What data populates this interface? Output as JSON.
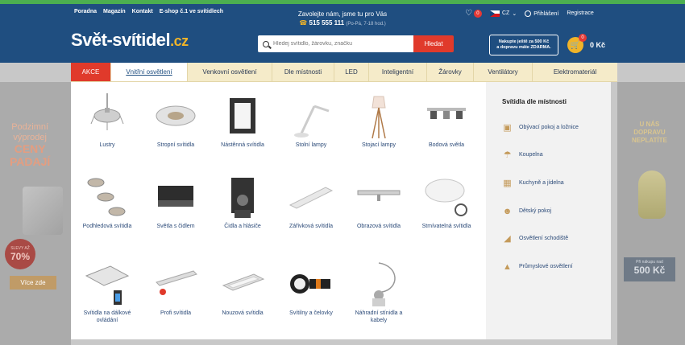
{
  "header": {
    "top_links": [
      "Poradna",
      "Magazín",
      "Kontakt",
      "E-shop č.1 ve svítidlech"
    ],
    "phone_title": "Zavolejte nám, jsme tu pro Vás",
    "phone_number": "515 555 111",
    "phone_hours": "(Po-Pá, 7-18 hod.)",
    "wishlist_count": "0",
    "lang": "CZ",
    "login": "Přihlášení",
    "register": "Registrace",
    "logo_main": "Svět-svítidel",
    "logo_tld": ".cz",
    "search_placeholder": "Hledej svítidlo, žárovku, značku",
    "search_button": "Hledat",
    "promo_line1": "Nakupte ještě za 500 Kč",
    "promo_line2": "a dopravu máte ZDARMA.",
    "cart_count": "0",
    "cart_price": "0 Kč"
  },
  "nav": {
    "items": [
      {
        "label": "AKCE"
      },
      {
        "label": "Vnitřní osvětlení"
      },
      {
        "label": "Venkovní osvětlení"
      },
      {
        "label": "Dle místnosti"
      },
      {
        "label": "LED"
      },
      {
        "label": "Inteligentní"
      },
      {
        "label": "Žárovky"
      },
      {
        "label": "Ventilátory"
      },
      {
        "label": "Elektromateriál"
      }
    ]
  },
  "menu": {
    "items": [
      {
        "label": "Lustry",
        "icon": "chandelier-icon"
      },
      {
        "label": "Stropní svítidla",
        "icon": "ceiling-light-icon"
      },
      {
        "label": "Nástěnná svítidla",
        "icon": "wall-light-icon"
      },
      {
        "label": "Stolní lampy",
        "icon": "desk-lamp-icon"
      },
      {
        "label": "Stojací lampy",
        "icon": "floor-lamp-icon"
      },
      {
        "label": "Bodová světla",
        "icon": "spotlight-icon"
      },
      {
        "label": "Podhledová svítidla",
        "icon": "recessed-light-icon"
      },
      {
        "label": "Světla s čidlem",
        "icon": "sensor-light-icon"
      },
      {
        "label": "Čidla a hlásiče",
        "icon": "sensor-icon"
      },
      {
        "label": "Zářivková svítidla",
        "icon": "fluorescent-light-icon"
      },
      {
        "label": "Obrazová svítidla",
        "icon": "picture-light-icon"
      },
      {
        "label": "Stmívatelná svítidla",
        "icon": "dimmable-light-icon"
      },
      {
        "label": "Svítidla na dálkové ovládání",
        "icon": "remote-light-icon"
      },
      {
        "label": "Profi svítidla",
        "icon": "pro-light-icon"
      },
      {
        "label": "Nouzová svítidla",
        "icon": "emergency-light-icon"
      },
      {
        "label": "Svítilny a čelovky",
        "icon": "flashlight-icon"
      },
      {
        "label": "Náhradní stínidla a kabely",
        "icon": "shade-cable-icon"
      }
    ]
  },
  "rooms": {
    "title": "Svítidla dle místnosti",
    "items": [
      {
        "label": "Obývací pokoj a ložnice",
        "icon": "sofa-icon"
      },
      {
        "label": "Koupelna",
        "icon": "shower-icon"
      },
      {
        "label": "Kuchyně a jídelna",
        "icon": "stove-icon"
      },
      {
        "label": "Dětský pokoj",
        "icon": "teddy-icon"
      },
      {
        "label": "Osvětlení schodiště",
        "icon": "stairs-icon"
      },
      {
        "label": "Průmyslové osvětlení",
        "icon": "industrial-lamp-icon"
      }
    ]
  },
  "banner_left": {
    "line1": "Podzimní",
    "line2": "výprodej",
    "line3": "CENY",
    "line4": "PADAJÍ",
    "badge_top": "SLEVY AŽ",
    "badge_value": "70%",
    "button": "Více zde"
  },
  "banner_right": {
    "line1": "U NÁS",
    "line2": "DOPRAVU",
    "line3": "NEPLATÍTE",
    "box_top": "Při nákupu nad",
    "box_value": "500 Kč"
  }
}
